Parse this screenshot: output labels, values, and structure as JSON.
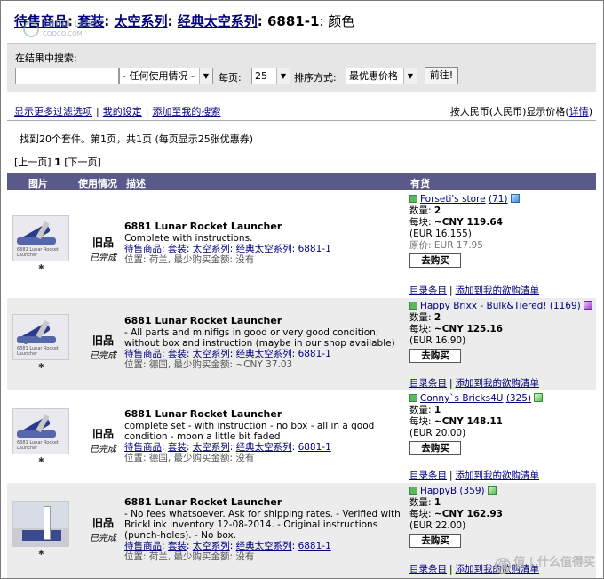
{
  "breadcrumb": {
    "items": [
      "待售商品",
      "套装",
      "太空系列",
      "经典太空系列"
    ],
    "tail_id": "6881-1",
    "tail_suffix": ": 颜色"
  },
  "watermark_top": {
    "line1": "CHINA LEGO",
    "line2": "COOCO.COM"
  },
  "search": {
    "label": "在结果中搜索:",
    "query_value": "",
    "usage_select": "- 任何使用情况 -",
    "per_page_label": "每页:",
    "per_page_value": "25",
    "sort_label": "排序方式:",
    "sort_value": "最优惠价格",
    "go_button": "前往!"
  },
  "links": {
    "more_filters": "显示更多过滤选项",
    "my_settings": "我的设定",
    "add_to_search": "添加至我的搜索",
    "currency_prefix": "按人民币(人民币)显示价格",
    "currency_details": "详情"
  },
  "results_summary": "找到20个套件。第1页，共1页 (每页显示25张优惠券)",
  "pager": {
    "prev": "[上一页]",
    "current": "1",
    "next": "[下一页]"
  },
  "table_headers": {
    "image": "图片",
    "condition": "使用情况",
    "description": "描述",
    "availability": "有货"
  },
  "common": {
    "cond_main": "旧品",
    "cond_sub": "已完成",
    "title": "6881 Lunar Rocket Launcher",
    "cat1": "待售商品",
    "cat2": "套装",
    "cat3": "太空系列",
    "cat4": "经典太空系列",
    "item_id": "6881-1",
    "qty_label": "数量:",
    "each_label": "每块:",
    "buy_button": "去购买",
    "catalog_link": "目录条目",
    "wishlist_link": "添加到我的欲购清单",
    "thumb_caption": "6881 Lunar Rocket Launcher"
  },
  "listings": [
    {
      "desc": "Complete with instructions.",
      "location": "位置: 荷兰, 最少购买金额: 没有",
      "store": "Forseti's store",
      "feedback": "(71)",
      "qty": "2",
      "price": "~CNY 119.64",
      "eur": "(EUR 16.155)",
      "orig_label": "原价: ",
      "orig_price": "EUR 17.95"
    },
    {
      "desc": "- All parts and minifigs in good or very good condition; without box and instruction (maybe in our shop available)",
      "location": "位置: 德国, 最少购买金额: ~CNY 37.03",
      "store": "Happy Brixx - Bulk&Tiered!",
      "feedback": "(1169)",
      "qty": "2",
      "price": "~CNY 125.16",
      "eur": "(EUR 16.90)"
    },
    {
      "desc": "complete set - with instruction - no box - all in a good condition - moon a little bit faded",
      "location": "位置: 德国, 最少购买金额: 没有",
      "store": "Conny`s Bricks4U",
      "feedback": "(325)",
      "qty": "1",
      "price": "~CNY 148.11",
      "eur": "(EUR 20.00)"
    },
    {
      "desc": "- No fees whatsoever. Ask for shipping rates. - Verified with BrickLink inventory 12-08-2014. - Original instructions (punch-holes). - No box.",
      "location": "位置: 荷兰, 最少购买金额: 没有",
      "store": "HappyB",
      "feedback": "(359)",
      "qty": "1",
      "price": "~CNY 162.93",
      "eur": "(EUR 22.00)"
    }
  ],
  "watermark_bottom": "值 | 什么值得买",
  "colors": {
    "header_bg": "#5a5a8a",
    "link": "#000080",
    "bar_bg": "#e6e6e6"
  }
}
